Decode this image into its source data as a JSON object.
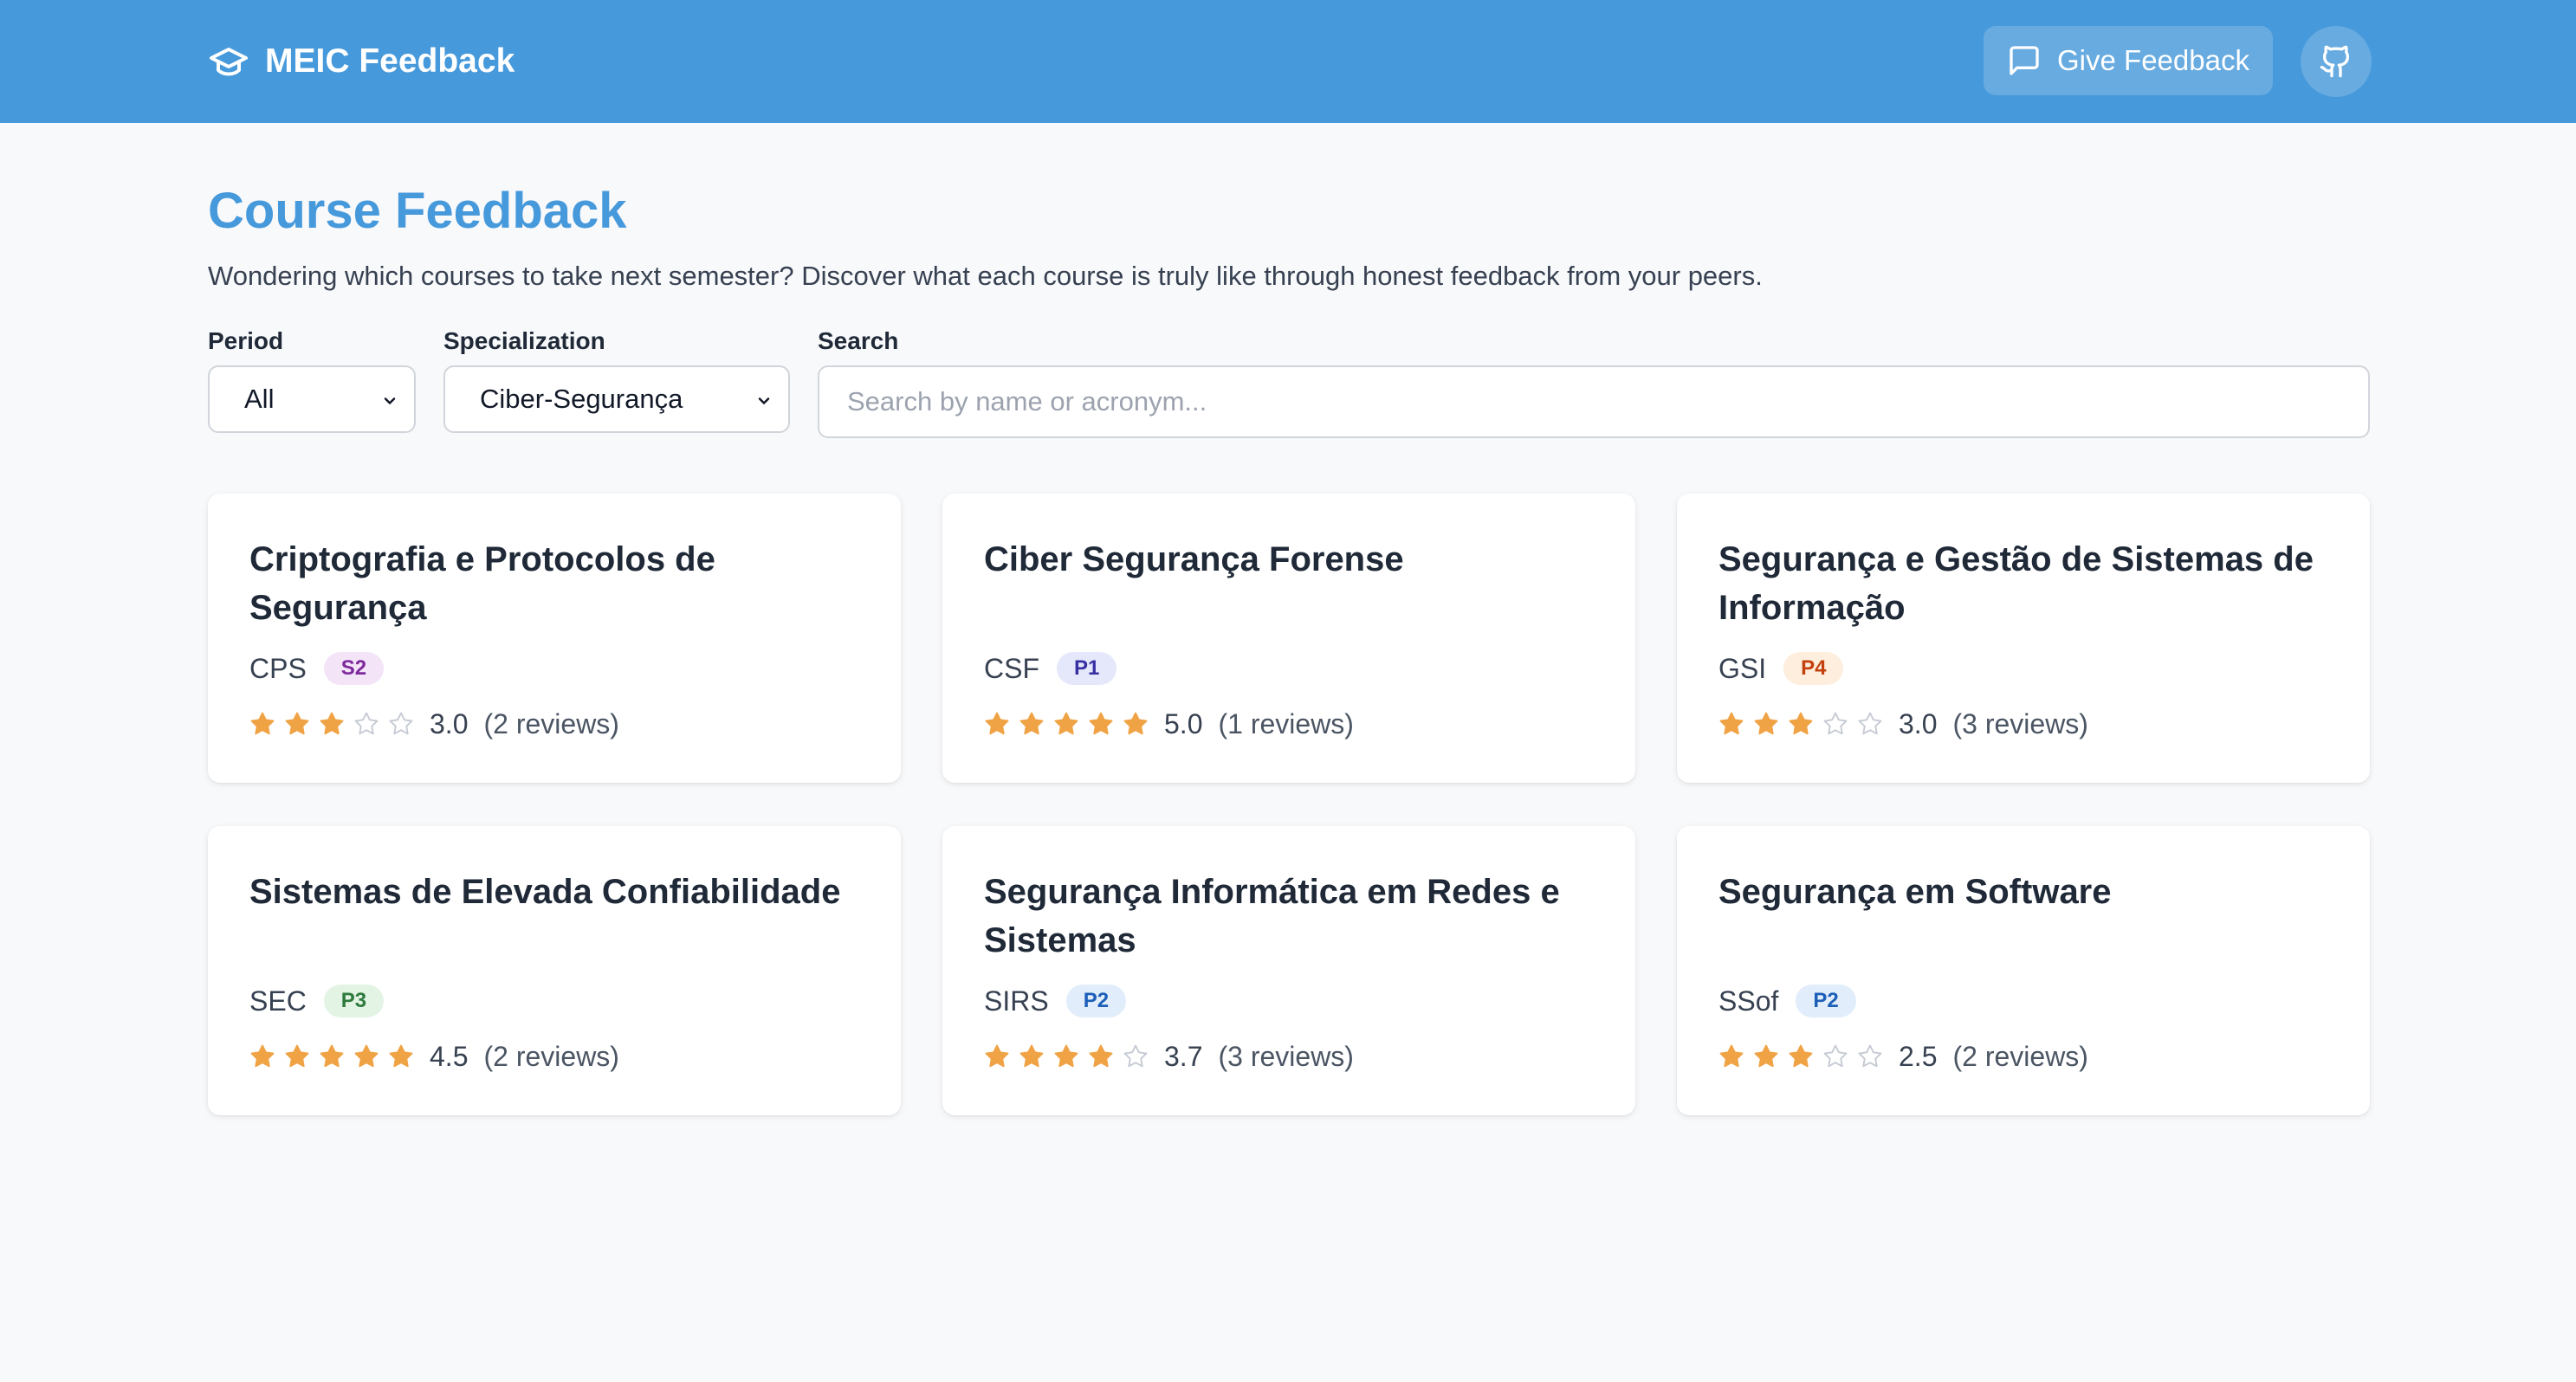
{
  "app": {
    "title": "MEIC Feedback"
  },
  "nav": {
    "give_feedback_label": "Give Feedback"
  },
  "page": {
    "title": "Course Feedback",
    "subtitle": "Wondering which courses to take next semester? Discover what each course is truly like through honest feedback from your peers."
  },
  "filters": {
    "period": {
      "label": "Period",
      "value": "All"
    },
    "specialization": {
      "label": "Specialization",
      "value": "Ciber-Segurança"
    },
    "search": {
      "label": "Search",
      "placeholder": "Search by name or acronym...",
      "value": ""
    }
  },
  "colors": {
    "primary": "#4699db",
    "star_filled": "#f0a345",
    "star_empty": "#c5cad3"
  },
  "courses": [
    {
      "title": "Criptografia e Protocolos de Segurança",
      "acronym": "CPS",
      "period": "S2",
      "period_bg": "#f3e4f8",
      "period_fg": "#7e2a9c",
      "rating": 3.0,
      "rating_text": "3.0",
      "reviews": "(2 reviews)"
    },
    {
      "title": "Ciber Segurança Forense",
      "acronym": "CSF",
      "period": "P1",
      "period_bg": "#e5e7fb",
      "period_fg": "#3730a3",
      "rating": 5.0,
      "rating_text": "5.0",
      "reviews": "(1 reviews)"
    },
    {
      "title": "Segurança e Gestão de Sistemas de Informação",
      "acronym": "GSI",
      "period": "P4",
      "period_bg": "#fdeedd",
      "period_fg": "#c2410c",
      "rating": 3.0,
      "rating_text": "3.0",
      "reviews": "(3 reviews)"
    },
    {
      "title": "Sistemas de Elevada Confiabilidade",
      "acronym": "SEC",
      "period": "P3",
      "period_bg": "#e3f4e5",
      "period_fg": "#2f7a3d",
      "rating": 4.5,
      "rating_text": "4.5",
      "reviews": "(2 reviews)"
    },
    {
      "title": "Segurança Informática em Redes e Sistemas",
      "acronym": "SIRS",
      "period": "P2",
      "period_bg": "#e1edfb",
      "period_fg": "#1d5fb8",
      "rating": 3.7,
      "rating_text": "3.7",
      "reviews": "(3 reviews)"
    },
    {
      "title": "Segurança em Software",
      "acronym": "SSof",
      "period": "P2",
      "period_bg": "#e1edfb",
      "period_fg": "#1d5fb8",
      "rating": 2.5,
      "rating_text": "2.5",
      "reviews": "(2 reviews)"
    }
  ]
}
